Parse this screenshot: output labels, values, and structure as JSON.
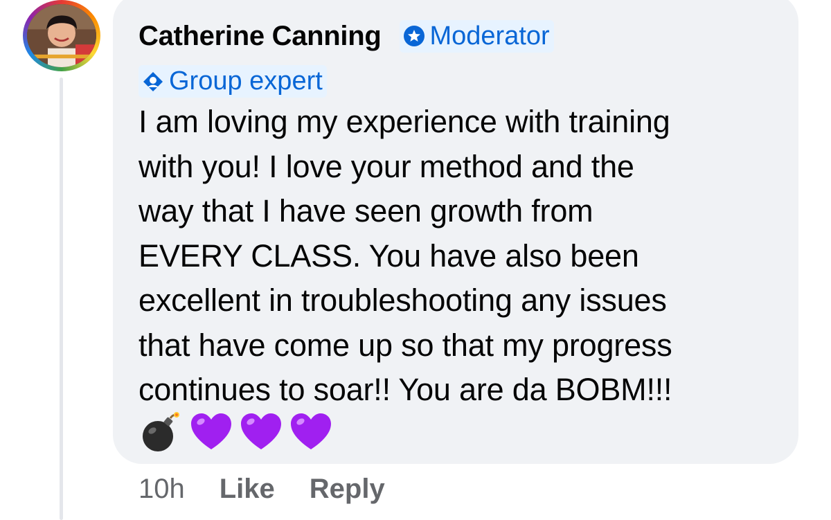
{
  "comment": {
    "author": "Catherine Canning",
    "badges": {
      "moderator": "Moderator",
      "group_expert": "Group expert"
    },
    "text_lines": [
      "I am loving my experience with training",
      "with you! I love your method and the",
      "way that I have seen growth from",
      "EVERY CLASS. You have also been",
      "excellent in troubleshooting any issues",
      "that have come up so that my progress",
      "continues to soar!! You are da BOBM!!!"
    ],
    "emojis": [
      "bomb-emoji",
      "purple-heart-emoji",
      "purple-heart-emoji",
      "purple-heart-emoji"
    ],
    "timestamp": "10h",
    "actions": {
      "like": "Like",
      "reply": "Reply"
    }
  },
  "colors": {
    "bubble_bg": "#f0f2f5",
    "badge_bg": "#e7f3ff",
    "badge_text": "#0866d6",
    "meta_text": "#65676b",
    "heart": "#a020f0"
  }
}
